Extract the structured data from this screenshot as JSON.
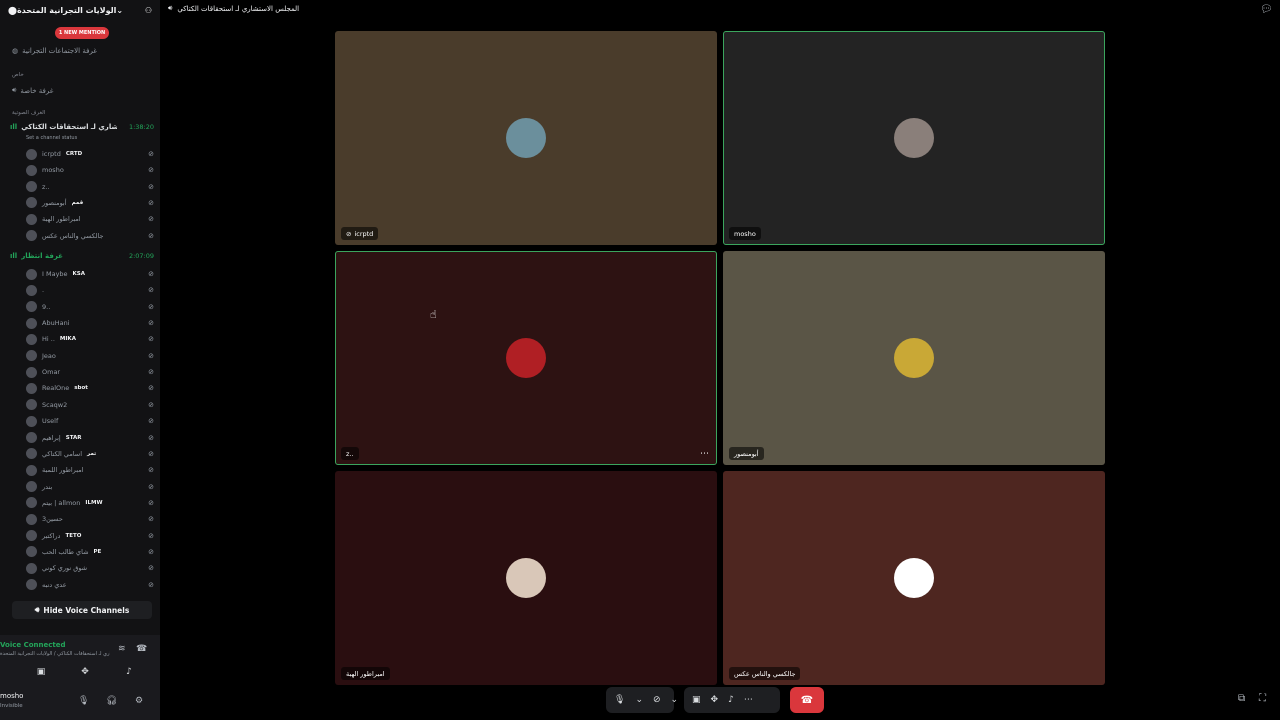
{
  "server": {
    "name": "الولايات التجرانية المتحدة"
  },
  "mention_badge": "1 NEW MENTION",
  "channels": {
    "meeting_room": "غرفة الاجتماعات التجرانية",
    "private_category": "خاص",
    "private_room": "غرفة خاصة",
    "voice_category": "الغرف الصوتية"
  },
  "voice_channel_1": {
    "name": "المجلس الاستشاري لـ استحقاقات الكتاكي",
    "timer": "1:38:20",
    "status_hint": "Set a channel status",
    "members": [
      {
        "name": "icrptd",
        "tag": "CRTD"
      },
      {
        "name": "mosho",
        "tag": ""
      },
      {
        "name": "z..",
        "tag": ""
      },
      {
        "name": "أبومنصور",
        "tag": "قمم"
      },
      {
        "name": "امبراطور الهبة",
        "tag": ""
      },
      {
        "name": "جالكسي والناس عكس",
        "tag": ""
      }
    ]
  },
  "voice_channel_2": {
    "name": "غرفة انتظار",
    "timer": "2:07:09",
    "members": [
      {
        "name": "I Maybe",
        "tag": "KSA"
      },
      {
        "name": ".",
        "tag": ""
      },
      {
        "name": "9..",
        "tag": ""
      },
      {
        "name": "AbuHani",
        "tag": ""
      },
      {
        "name": "Hi ..",
        "tag": "MIKA"
      },
      {
        "name": "Jeao",
        "tag": ""
      },
      {
        "name": "Omar",
        "tag": ""
      },
      {
        "name": "RealOne",
        "tag": "sbot"
      },
      {
        "name": "Scaqw2",
        "tag": ""
      },
      {
        "name": "Uself",
        "tag": ""
      },
      {
        "name": "إبراهيم",
        "tag": "STAR"
      },
      {
        "name": "اسامي الكتاكي",
        "tag": "تمر"
      },
      {
        "name": "امبراطور اللمبة",
        "tag": ""
      },
      {
        "name": "بندر",
        "tag": ""
      },
      {
        "name": "بيتم | allmon",
        "tag": "ILMW"
      },
      {
        "name": "حسين3",
        "tag": ""
      },
      {
        "name": "دراكتبر",
        "tag": "TETO"
      },
      {
        "name": "شاي طالب الحب",
        "tag": "PE"
      },
      {
        "name": "شوق نوري كوني",
        "tag": ""
      },
      {
        "name": "عدي دنبه",
        "tag": ""
      }
    ]
  },
  "hide_voice_label": "Hide Voice Channels",
  "connection": {
    "status": "Voice Connected",
    "path": "المجلس الاستشاري لـ استحقاقات الكتاكي / الولايات التجرانية المتحدة"
  },
  "user": {
    "name": "mosho",
    "status": "Invisible"
  },
  "call": {
    "channel_title": "المجلس الاستشاري لـ استحقاقات الكتاكي",
    "tiles": [
      {
        "name": "icrptd",
        "bg": "#4a3c2b",
        "avatar_color": "#6b8f9c",
        "speaking": false,
        "muted": true
      },
      {
        "name": "mosho",
        "bg": "#232323",
        "avatar_color": "#8a7f7a",
        "speaking": true,
        "muted": false
      },
      {
        "name": "z..",
        "bg": "#2d1212",
        "avatar_color": "#b01f24",
        "speaking": true,
        "muted": false
      },
      {
        "name": "أبومنصور",
        "bg": "#5a5546",
        "avatar_color": "#c9a836",
        "speaking": false,
        "muted": false
      },
      {
        "name": "امبراطور الهبة",
        "bg": "#2a0e10",
        "avatar_color": "#d9c7b8",
        "speaking": false,
        "muted": false
      },
      {
        "name": "جالكسي والناس عكس",
        "bg": "#4e2620",
        "avatar_color": "#ffffff",
        "speaking": false,
        "muted": false
      }
    ]
  },
  "colors": {
    "accent_green": "#23a55a",
    "danger": "#da373c",
    "sidebar": "#121214"
  }
}
